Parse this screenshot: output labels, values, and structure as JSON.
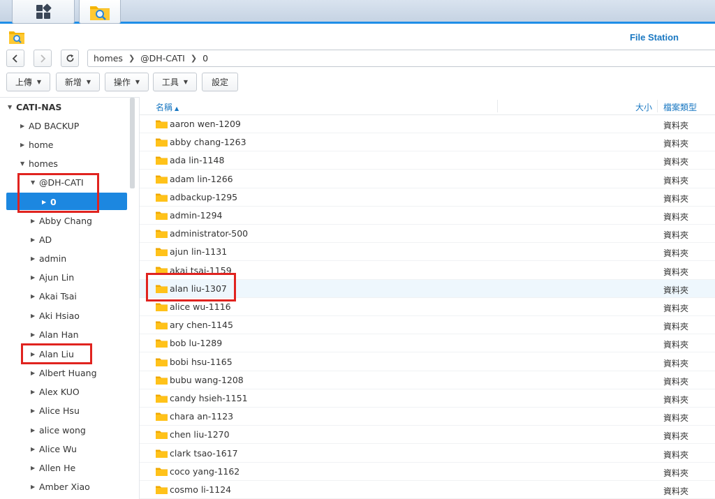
{
  "app": {
    "title": "File Station"
  },
  "taskbar": {
    "items": [
      {
        "name": "main-menu",
        "icon": "grid-icon"
      },
      {
        "name": "file-station",
        "icon": "folder-search-icon"
      }
    ]
  },
  "nav": {
    "back_icon": "chevron-left-icon",
    "forward_icon": "chevron-right-icon",
    "refresh_icon": "refresh-icon",
    "path": [
      "homes",
      "@DH-CATI",
      "0"
    ]
  },
  "toolbar": {
    "upload": "上傳",
    "create": "新增",
    "action": "操作",
    "tools": "工具",
    "settings": "設定"
  },
  "tree": {
    "root": "CATI-NAS",
    "items": [
      {
        "label": "AD BACKUP"
      },
      {
        "label": "home"
      },
      {
        "label": "homes"
      },
      {
        "label": "@DH-CATI"
      },
      {
        "label": "0"
      },
      {
        "label": "Abby Chang"
      },
      {
        "label": "AD"
      },
      {
        "label": "admin"
      },
      {
        "label": "Ajun Lin"
      },
      {
        "label": "Akai Tsai"
      },
      {
        "label": "Aki Hsiao"
      },
      {
        "label": "Alan Han"
      },
      {
        "label": "Alan Liu"
      },
      {
        "label": "Albert Huang"
      },
      {
        "label": "Alex KUO"
      },
      {
        "label": "Alice Hsu"
      },
      {
        "label": "alice wong"
      },
      {
        "label": "Alice Wu"
      },
      {
        "label": "Allen He"
      },
      {
        "label": "Amber Xiao"
      }
    ]
  },
  "list": {
    "columns": {
      "name": "名稱",
      "size": "大小",
      "type": "檔案類型"
    },
    "rows": [
      {
        "name": "aaron wen-1209",
        "type": "資料夾"
      },
      {
        "name": "abby chang-1263",
        "type": "資料夾"
      },
      {
        "name": "ada lin-1148",
        "type": "資料夾"
      },
      {
        "name": "adam lin-1266",
        "type": "資料夾"
      },
      {
        "name": "adbackup-1295",
        "type": "資料夾"
      },
      {
        "name": "admin-1294",
        "type": "資料夾"
      },
      {
        "name": "administrator-500",
        "type": "資料夾"
      },
      {
        "name": "ajun lin-1131",
        "type": "資料夾"
      },
      {
        "name": "akai tsai-1159",
        "type": "資料夾"
      },
      {
        "name": "alan liu-1307",
        "type": "資料夾"
      },
      {
        "name": "alice wu-1116",
        "type": "資料夾"
      },
      {
        "name": "ary chen-1145",
        "type": "資料夾"
      },
      {
        "name": "bob lu-1289",
        "type": "資料夾"
      },
      {
        "name": "bobi hsu-1165",
        "type": "資料夾"
      },
      {
        "name": "bubu wang-1208",
        "type": "資料夾"
      },
      {
        "name": "candy hsieh-1151",
        "type": "資料夾"
      },
      {
        "name": "chara an-1123",
        "type": "資料夾"
      },
      {
        "name": "chen liu-1270",
        "type": "資料夾"
      },
      {
        "name": "clark tsao-1617",
        "type": "資料夾"
      },
      {
        "name": "coco yang-1162",
        "type": "資料夾"
      },
      {
        "name": "cosmo li-1124",
        "type": "資料夾"
      }
    ]
  },
  "colors": {
    "accent": "#1c87e0",
    "highlight_box": "#e0231f",
    "folder": "#f5b400"
  }
}
